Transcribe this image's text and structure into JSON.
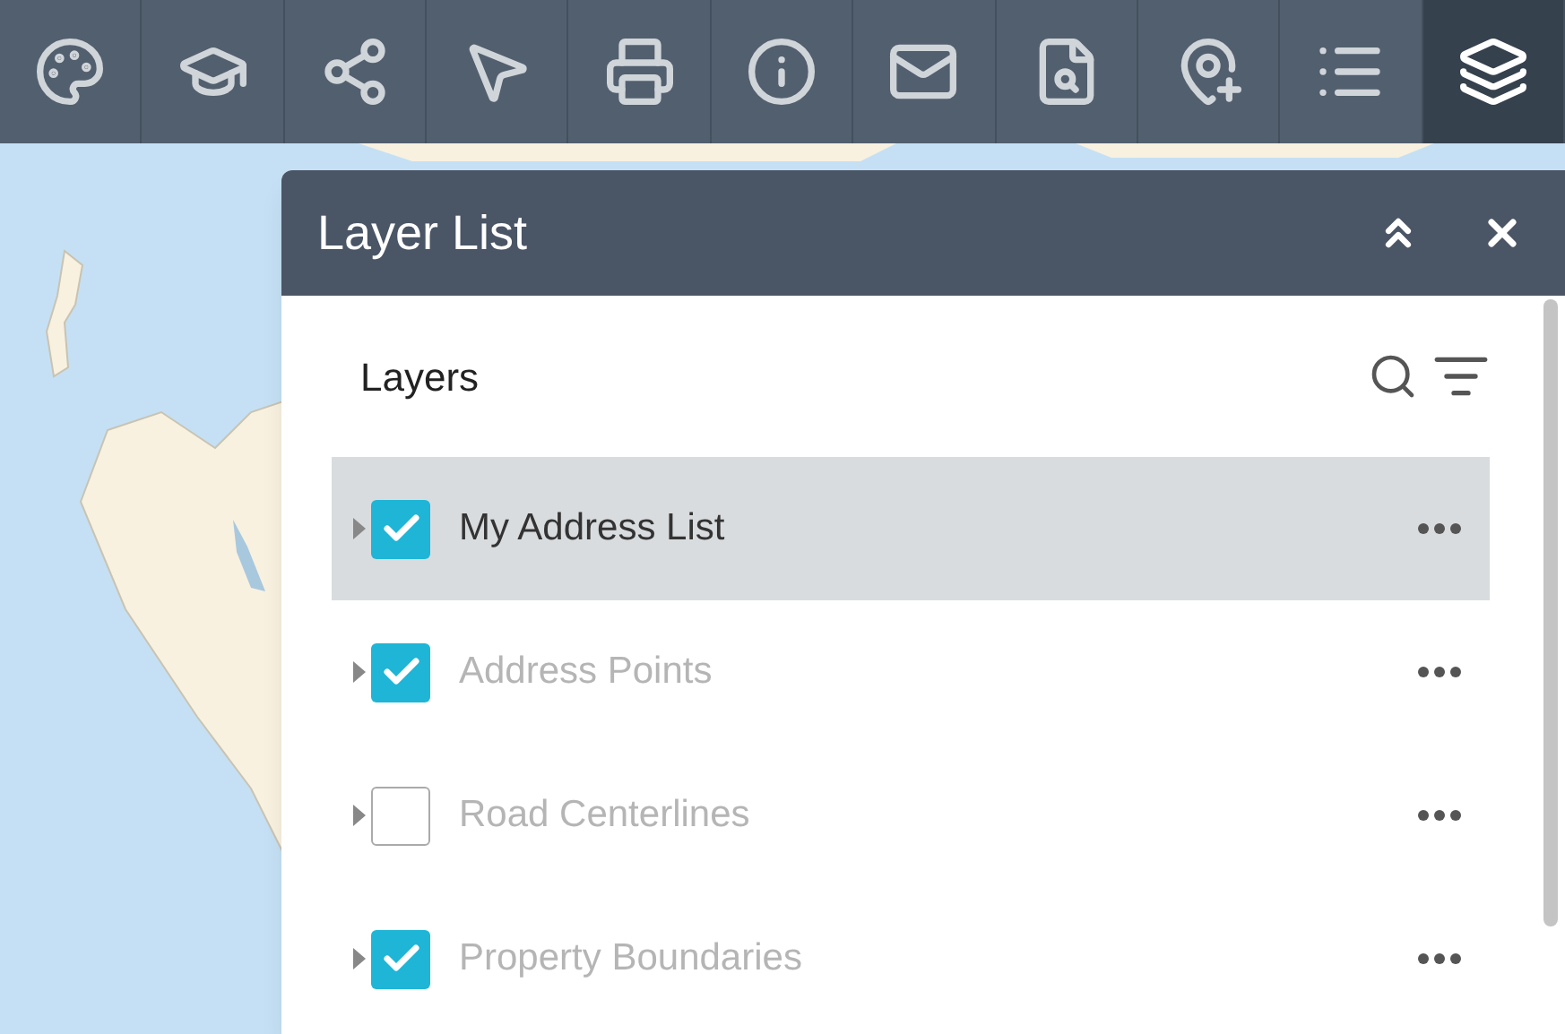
{
  "toolbar": [
    {
      "selected": false
    },
    {
      "selected": false
    },
    {
      "selected": false
    },
    {
      "selected": false
    },
    {
      "selected": false
    },
    {
      "selected": false
    },
    {
      "selected": false
    },
    {
      "selected": false
    },
    {
      "selected": false
    },
    {
      "selected": false
    },
    {
      "selected": true
    }
  ],
  "panel": {
    "title": "Layer List",
    "heading": "Layers",
    "layers": [
      {
        "name": "My Address List",
        "selected": true,
        "checked": true,
        "disabled": false
      },
      {
        "name": "Address Points",
        "selected": false,
        "checked": true,
        "disabled": true
      },
      {
        "name": "Road Centerlines",
        "selected": false,
        "checked": false,
        "disabled": true
      },
      {
        "name": "Property Boundaries",
        "selected": false,
        "checked": true,
        "disabled": true
      }
    ]
  }
}
